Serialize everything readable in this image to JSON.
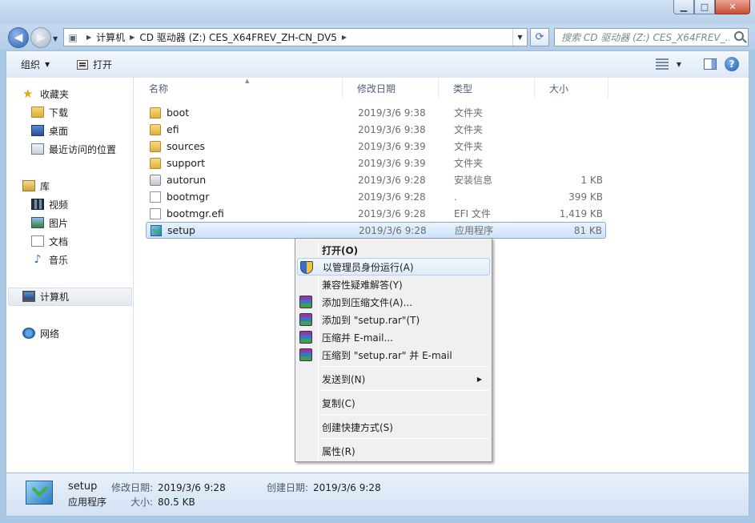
{
  "window": {
    "min_label": "▁",
    "max_label": "□",
    "close_label": "✕"
  },
  "address": {
    "crumbs": [
      "计算机",
      "CD 驱动器 (Z:) CES_X64FREV_ZH-CN_DV5"
    ],
    "search_placeholder": "搜索 CD 驱动器 (Z:) CES_X64FREV_..."
  },
  "toolbar": {
    "organize_label": "组织",
    "open_label": "打开"
  },
  "nav": {
    "favorites_label": "收藏夹",
    "favorites": [
      "下载",
      "桌面",
      "最近访问的位置"
    ],
    "libraries_label": "库",
    "libraries": [
      "视频",
      "图片",
      "文档",
      "音乐"
    ],
    "computer_label": "计算机",
    "network_label": "网络"
  },
  "columns": {
    "name": "名称",
    "date": "修改日期",
    "type": "类型",
    "size": "大小"
  },
  "files": [
    {
      "name": "boot",
      "date": "2019/3/6 9:38",
      "type": "文件夹",
      "size": ""
    },
    {
      "name": "efi",
      "date": "2019/3/6 9:38",
      "type": "文件夹",
      "size": ""
    },
    {
      "name": "sources",
      "date": "2019/3/6 9:39",
      "type": "文件夹",
      "size": ""
    },
    {
      "name": "support",
      "date": "2019/3/6 9:39",
      "type": "文件夹",
      "size": ""
    },
    {
      "name": "autorun",
      "date": "2019/3/6 9:28",
      "type": "安装信息",
      "size": "1 KB"
    },
    {
      "name": "bootmgr",
      "date": "2019/3/6 9:28",
      "type": ".",
      "size": "399 KB"
    },
    {
      "name": "bootmgr.efi",
      "date": "2019/3/6 9:28",
      "type": "EFI 文件",
      "size": "1,419 KB"
    },
    {
      "name": "setup",
      "date": "2019/3/6 9:28",
      "type": "应用程序",
      "size": "81 KB"
    }
  ],
  "context_menu": {
    "open": "打开(O)",
    "run_as_admin": "以管理员身份运行(A)",
    "troubleshoot": "兼容性疑难解答(Y)",
    "add_archive": "添加到压缩文件(A)...",
    "add_setup_rar": "添加到 \"setup.rar\"(T)",
    "compress_email": "压缩并 E-mail...",
    "compress_setup_email": "压缩到 \"setup.rar\" 并 E-mail",
    "send_to": "发送到(N)",
    "copy": "复制(C)",
    "create_shortcut": "创建快捷方式(S)",
    "properties": "属性(R)"
  },
  "details": {
    "name": "setup",
    "type": "应用程序",
    "modified_label": "修改日期:",
    "modified": "2019/3/6 9:28",
    "created_label": "创建日期:",
    "created": "2019/3/6 9:28",
    "size_label": "大小:",
    "size": "80.5 KB"
  }
}
